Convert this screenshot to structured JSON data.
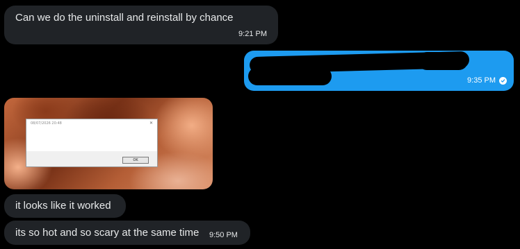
{
  "messages": {
    "m1": {
      "text": "Can we do the uninstall and reinstall by chance",
      "time": "9:21 PM"
    },
    "m2": {
      "time": "9:35 PM"
    },
    "attachment": {
      "dialog_title": "08/07/2026 20:48",
      "dialog_close": "✕",
      "dialog_button": "OK"
    },
    "m3": {
      "text": "it looks like it worked"
    },
    "m4": {
      "text": "its so hot and so scary at the same time",
      "time": "9:50 PM"
    }
  },
  "colors": {
    "background": "#000000",
    "incoming_bubble": "#202327",
    "outgoing_bubble": "#1d9bf0",
    "text": "#e7e9ea"
  }
}
